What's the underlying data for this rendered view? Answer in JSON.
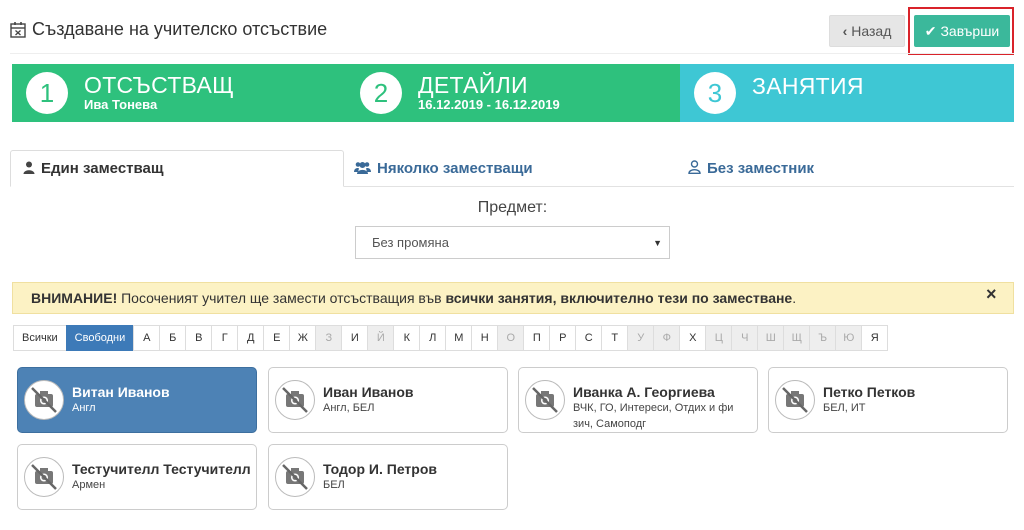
{
  "header": {
    "title": "Създаване на учителско отсъствие",
    "back_label": "Назад",
    "finish_label": "Завърши"
  },
  "steps": [
    {
      "num": "1",
      "title": "ОТСЪСТВАЩ",
      "sub": "Ива Тонева",
      "color": "#2ec17d"
    },
    {
      "num": "2",
      "title": "ДЕТАЙЛИ",
      "sub": "16.12.2019 - 16.12.2019",
      "color": "#2ec17d"
    },
    {
      "num": "3",
      "title": "ЗАНЯТИЯ",
      "sub": "",
      "color": "#3ec7d4"
    }
  ],
  "tabs": [
    {
      "label": "Един заместващ",
      "icon": "user-icon",
      "active": true
    },
    {
      "label": "Няколко заместващи",
      "icon": "users-icon",
      "active": false
    },
    {
      "label": "Без заместник",
      "icon": "user-outline-icon",
      "active": false
    }
  ],
  "subject": {
    "label": "Предмет:",
    "value": "Без промяна"
  },
  "alert": {
    "strong_prefix": "ВНИМАНИЕ!",
    "text": " Посоченият учител ще замести отсъстващия във ",
    "strong_mid": "всички занятия, включително тези по заместване",
    "suffix": ".",
    "close": "×"
  },
  "letters": [
    {
      "l": "Всички",
      "state": "normal"
    },
    {
      "l": "Свободни",
      "state": "selected"
    },
    {
      "l": "А",
      "state": "normal"
    },
    {
      "l": "Б",
      "state": "normal"
    },
    {
      "l": "В",
      "state": "normal"
    },
    {
      "l": "Г",
      "state": "normal"
    },
    {
      "l": "Д",
      "state": "normal"
    },
    {
      "l": "Е",
      "state": "normal"
    },
    {
      "l": "Ж",
      "state": "normal"
    },
    {
      "l": "З",
      "state": "disabled"
    },
    {
      "l": "И",
      "state": "normal"
    },
    {
      "l": "Й",
      "state": "disabled"
    },
    {
      "l": "К",
      "state": "normal"
    },
    {
      "l": "Л",
      "state": "normal"
    },
    {
      "l": "М",
      "state": "normal"
    },
    {
      "l": "Н",
      "state": "normal"
    },
    {
      "l": "О",
      "state": "disabled"
    },
    {
      "l": "П",
      "state": "normal"
    },
    {
      "l": "Р",
      "state": "normal"
    },
    {
      "l": "С",
      "state": "normal"
    },
    {
      "l": "Т",
      "state": "normal"
    },
    {
      "l": "У",
      "state": "disabled"
    },
    {
      "l": "Ф",
      "state": "disabled"
    },
    {
      "l": "Х",
      "state": "normal"
    },
    {
      "l": "Ц",
      "state": "disabled"
    },
    {
      "l": "Ч",
      "state": "disabled"
    },
    {
      "l": "Ш",
      "state": "disabled"
    },
    {
      "l": "Щ",
      "state": "disabled"
    },
    {
      "l": "Ъ",
      "state": "disabled"
    },
    {
      "l": "Ю",
      "state": "disabled"
    },
    {
      "l": "Я",
      "state": "normal"
    }
  ],
  "teachers": [
    {
      "name": "Витан Иванов",
      "sub": "Англ",
      "active": true
    },
    {
      "name": "Иван Иванов",
      "sub": "Англ, БЕЛ",
      "active": false
    },
    {
      "name": "Иванка А. Георгиева",
      "sub": "ВЧК, ГО, Интереси, Отдих и фи зич, Самоподг",
      "active": false
    },
    {
      "name": "Петко Петков",
      "sub": "БЕЛ, ИТ",
      "active": false
    },
    {
      "name": "Тестучителл Тестучителл",
      "sub": "Армен",
      "active": false
    },
    {
      "name": "Тодор И. Петров",
      "sub": "БЕЛ",
      "active": false
    }
  ],
  "colors": {
    "accent_green": "#2ec17d",
    "accent_teal": "#3ec7d4",
    "finish_button": "#3bb89b",
    "selected_blue": "#4d82b5",
    "highlight_red": "#d9232a",
    "alert_bg": "#fcf2c4"
  }
}
